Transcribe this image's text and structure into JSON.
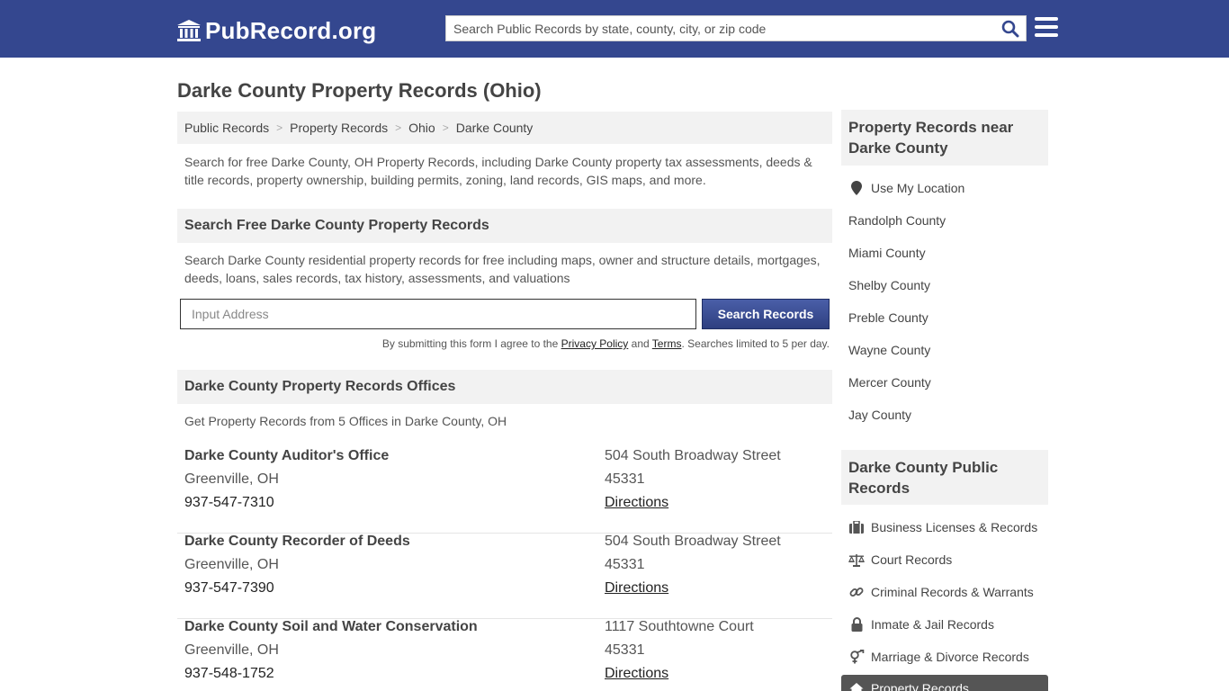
{
  "header": {
    "logo_text": "PubRecord.org",
    "search_placeholder": "Search Public Records by state, county, city, or zip code"
  },
  "page_title": "Darke County Property Records (Ohio)",
  "breadcrumb": [
    "Public Records",
    "Property Records",
    "Ohio",
    "Darke County"
  ],
  "intro": "Search for free Darke County, OH Property Records, including Darke County property tax assessments, deeds & title records, property ownership, building permits, zoning, land records, GIS maps, and more.",
  "search_section": {
    "title": "Search Free Darke County Property Records",
    "description": "Search Darke County residential property records for free including maps, owner and structure details, mortgages, deeds, loans, sales records, tax history, assessments, and valuations",
    "input_placeholder": "Input Address",
    "button_label": "Search Records",
    "disclaimer_prefix": "By submitting this form I agree to the ",
    "privacy_label": "Privacy Policy",
    "and": " and ",
    "terms_label": "Terms",
    "disclaimer_suffix": ". Searches limited to 5 per day."
  },
  "offices_section": {
    "title": "Darke County Property Records Offices",
    "description": "Get Property Records from 5 Offices in Darke County, OH",
    "offices": [
      {
        "name": "Darke County Auditor's Office",
        "city": "Greenville, OH",
        "phone": "937-547-7310",
        "street": "504 South Broadway Street",
        "zip": "45331",
        "directions": "Directions"
      },
      {
        "name": "Darke County Recorder of Deeds",
        "city": "Greenville, OH",
        "phone": "937-547-7390",
        "street": "504 South Broadway Street",
        "zip": "45331",
        "directions": "Directions"
      },
      {
        "name": "Darke County Soil and Water Conservation",
        "city": "Greenville, OH",
        "phone": "937-548-1752",
        "street": "1117 Southtowne Court",
        "zip": "45331",
        "directions": "Directions"
      }
    ]
  },
  "sidebar": {
    "nearby_title": "Property Records near Darke County",
    "use_location": "Use My Location",
    "nearby": [
      "Randolph County",
      "Miami County",
      "Shelby County",
      "Preble County",
      "Wayne County",
      "Mercer County",
      "Jay County"
    ],
    "public_title": "Darke County Public Records",
    "public_links": [
      {
        "label": "Business Licenses & Records",
        "icon": "briefcase-icon"
      },
      {
        "label": "Court Records",
        "icon": "scales-icon"
      },
      {
        "label": "Criminal Records & Warrants",
        "icon": "link-icon"
      },
      {
        "label": "Inmate & Jail Records",
        "icon": "lock-icon"
      },
      {
        "label": "Marriage & Divorce Records",
        "icon": "gender-icon"
      }
    ],
    "active_link": {
      "label": "Property Records",
      "icon": "home-icon"
    }
  },
  "colors": {
    "header": "#34478f",
    "button": "#34478f",
    "panel": "#f2f2f2"
  }
}
